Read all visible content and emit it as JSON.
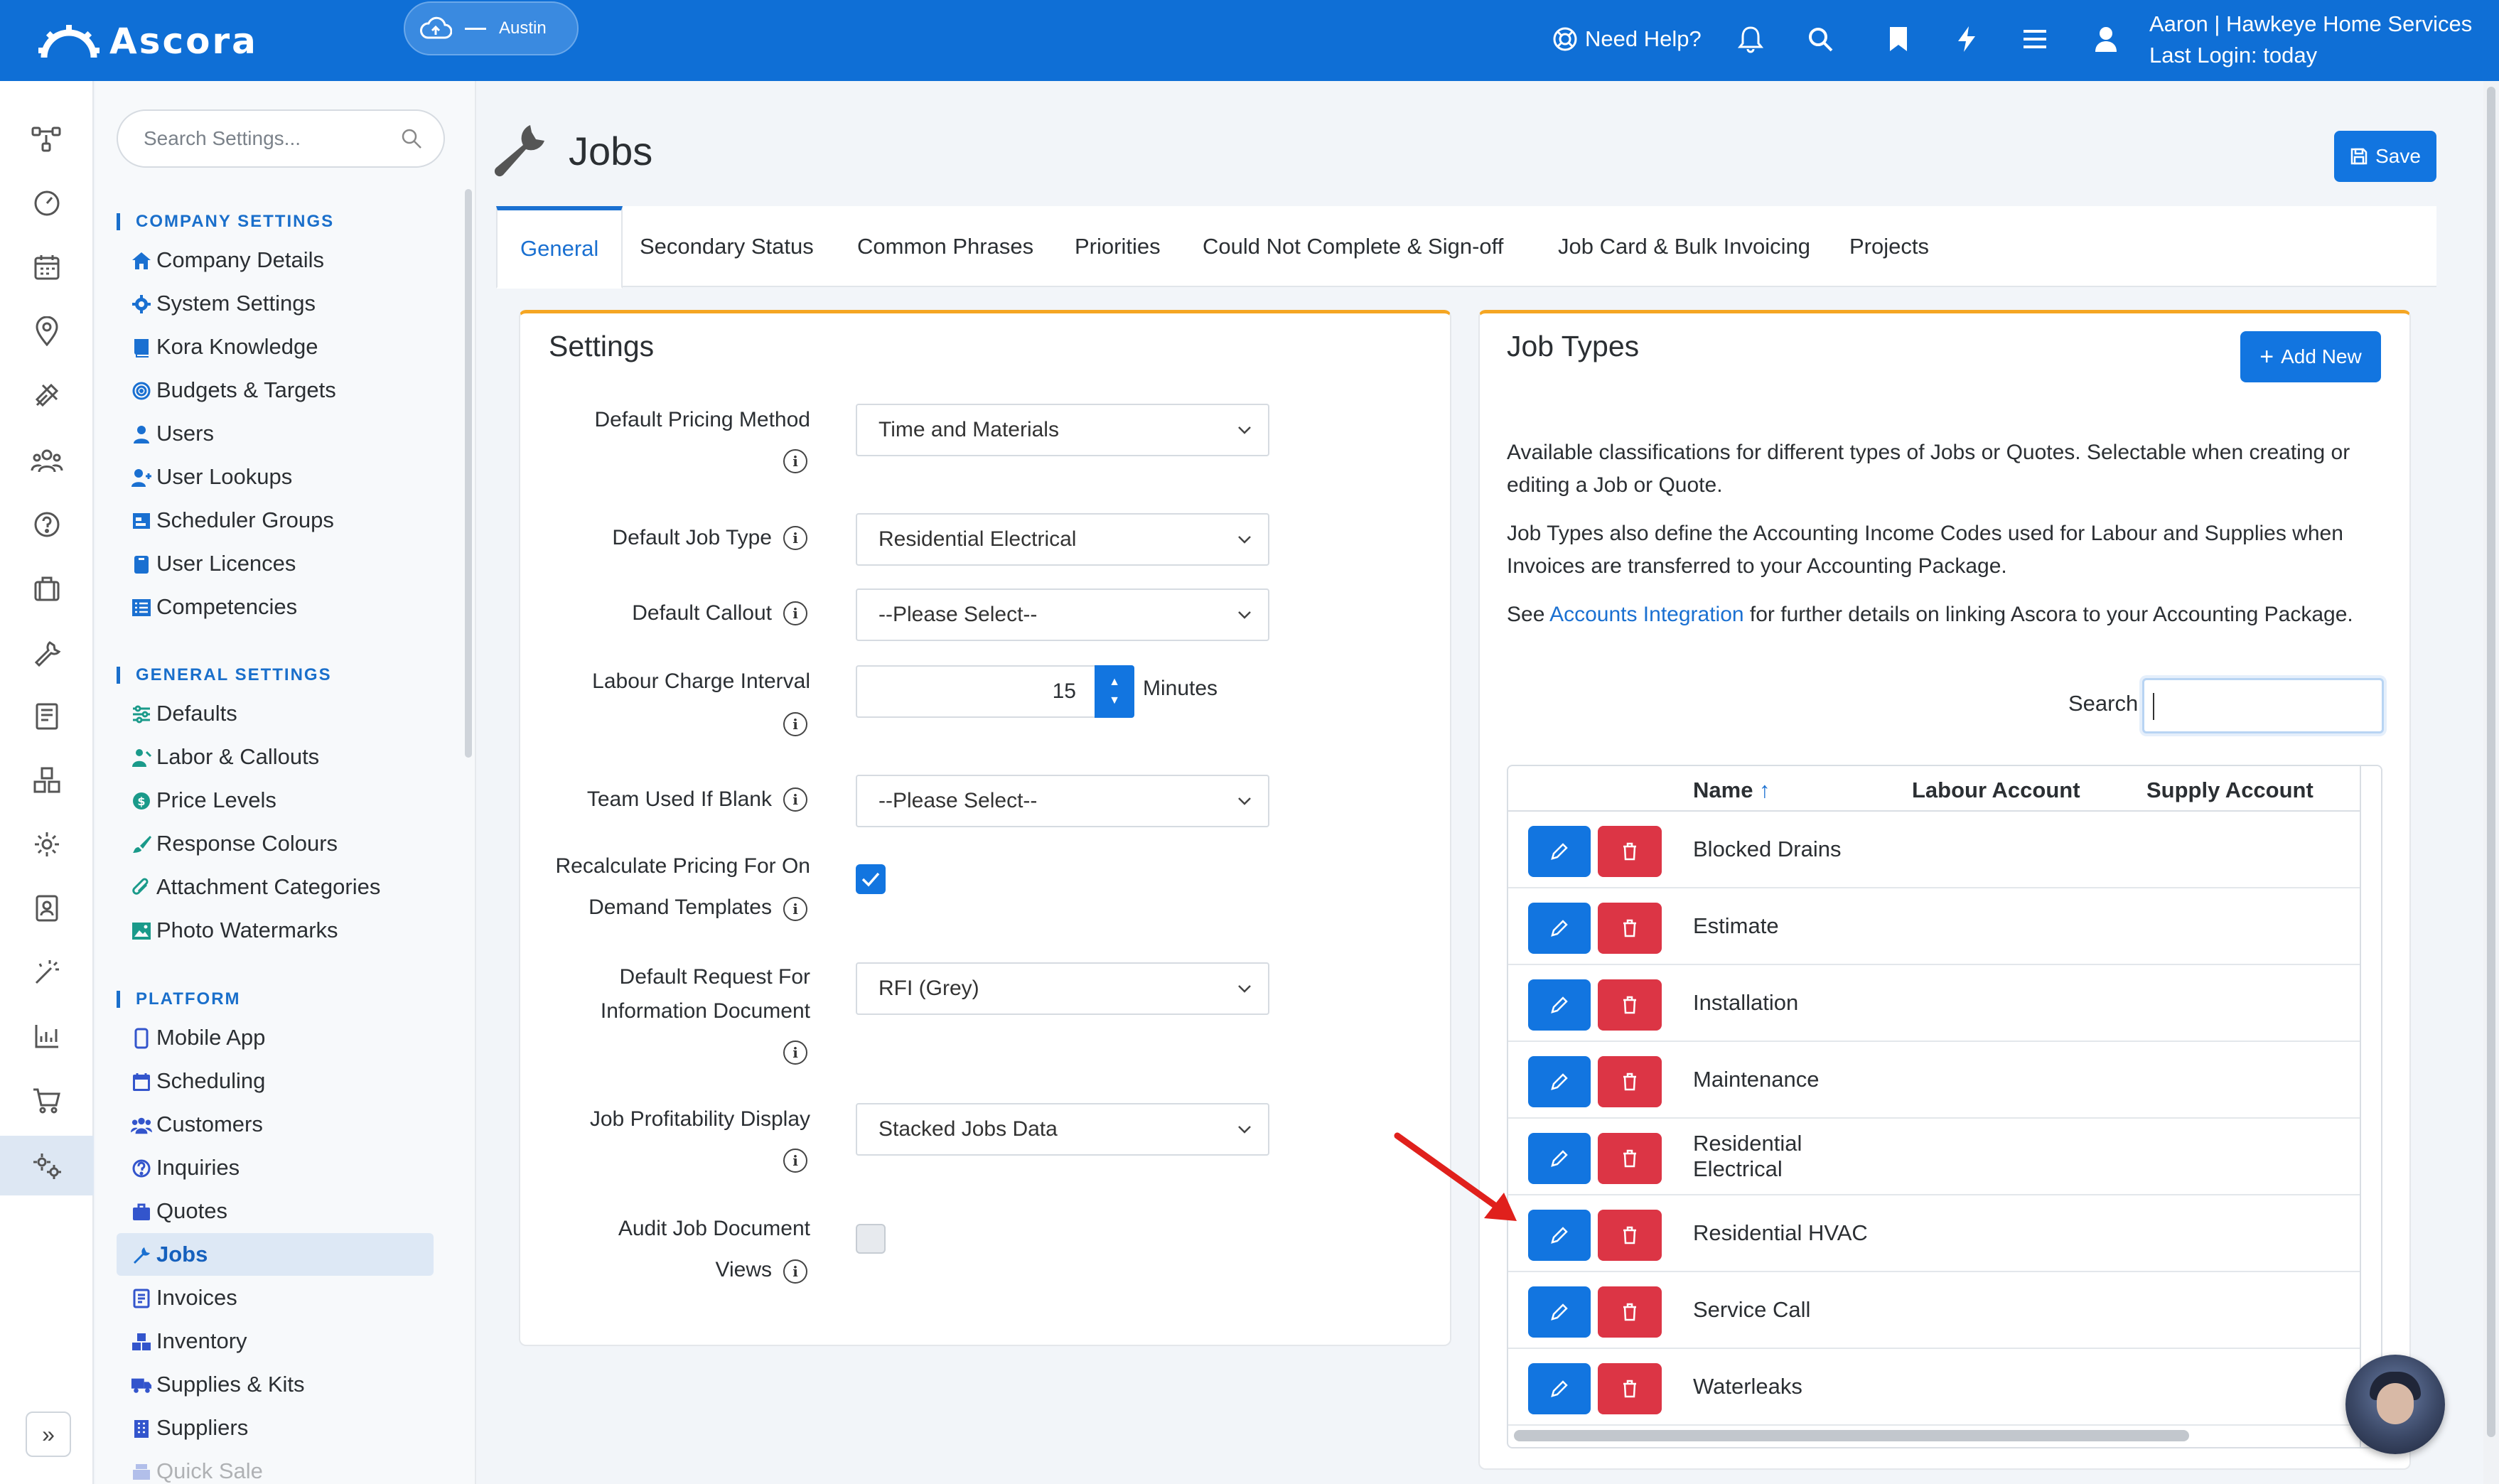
{
  "app": {
    "logo_text": "Ascora",
    "location": "Austin"
  },
  "topbar": {
    "help_label": "Need Help?",
    "user_line1": "Aaron | Hawkeye Home Services",
    "user_line2": "Last Login: today",
    "icons": [
      "bell-icon",
      "search-icon",
      "bookmark-icon",
      "lightning-icon",
      "menu-icon",
      "user-icon"
    ]
  },
  "sidebar": {
    "search_placeholder": "Search Settings...",
    "sections": [
      {
        "title": "COMPANY SETTINGS",
        "items": [
          {
            "label": "Company Details"
          },
          {
            "label": "System Settings"
          },
          {
            "label": "Kora Knowledge"
          },
          {
            "label": "Budgets & Targets"
          },
          {
            "label": "Users"
          },
          {
            "label": "User Lookups"
          },
          {
            "label": "Scheduler Groups"
          },
          {
            "label": "User Licences"
          },
          {
            "label": "Competencies"
          }
        ]
      },
      {
        "title": "GENERAL SETTINGS",
        "items": [
          {
            "label": "Defaults"
          },
          {
            "label": "Labor & Callouts"
          },
          {
            "label": "Price Levels"
          },
          {
            "label": "Response Colours"
          },
          {
            "label": "Attachment Categories"
          },
          {
            "label": "Photo Watermarks"
          }
        ]
      },
      {
        "title": "PLATFORM",
        "items": [
          {
            "label": "Mobile App"
          },
          {
            "label": "Scheduling"
          },
          {
            "label": "Customers"
          },
          {
            "label": "Inquiries"
          },
          {
            "label": "Quotes"
          },
          {
            "label": "Jobs"
          },
          {
            "label": "Invoices"
          },
          {
            "label": "Inventory"
          },
          {
            "label": "Supplies & Kits"
          },
          {
            "label": "Suppliers"
          },
          {
            "label": "Quick Sale"
          }
        ]
      }
    ]
  },
  "page": {
    "title": "Jobs",
    "save_label": "Save",
    "tabs": [
      "General",
      "Secondary Status",
      "Common Phrases",
      "Priorities",
      "Could Not Complete & Sign-off",
      "Job Card & Bulk Invoicing",
      "Projects"
    ],
    "active_tab": "General"
  },
  "settings": {
    "title": "Settings",
    "default_pricing_method": {
      "label": "Default Pricing Method",
      "value": "Time and Materials"
    },
    "default_job_type": {
      "label": "Default Job Type",
      "value": "Residential Electrical"
    },
    "default_callout": {
      "label": "Default Callout",
      "value": "--Please Select--"
    },
    "labour_charge_interval": {
      "label": "Labour Charge Interval",
      "value": "15",
      "unit": "Minutes"
    },
    "team_used_if_blank": {
      "label": "Team Used If Blank",
      "value": "--Please Select--"
    },
    "recalc_pricing": {
      "label_line1": "Recalculate Pricing For On",
      "label_line2": "Demand Templates",
      "checked": true
    },
    "default_rfi_doc": {
      "label_line1": "Default Request For",
      "label_line2": "Information Document",
      "value": "RFI (Grey)"
    },
    "job_profitability_display": {
      "label": "Job Profitability Display",
      "value": "Stacked Jobs Data"
    },
    "audit_job_doc_views": {
      "label_line1": "Audit Job Document",
      "label_line2": "Views",
      "checked": false
    }
  },
  "job_types": {
    "title": "Job Types",
    "add_label": "Add New",
    "desc1": "Available classifications for different types of Jobs or Quotes. Selectable when creating or editing a Job or Quote.",
    "desc2": "Job Types also define the Accounting Income Codes used for Labour and Supplies when Invoices are transferred to your Accounting Package.",
    "desc3_pre": "See ",
    "desc3_link": "Accounts Integration",
    "desc3_post": " for further details on linking Ascora to your Accounting Package.",
    "search_label": "Search",
    "search_value": "",
    "columns": {
      "name": "Name",
      "sort_arrow": "↑",
      "labour": "Labour Account",
      "supply": "Supply Account"
    },
    "rows": [
      {
        "name": "Blocked Drains"
      },
      {
        "name": "Estimate"
      },
      {
        "name": "Installation"
      },
      {
        "name": "Maintenance"
      },
      {
        "name": "Residential Electrical"
      },
      {
        "name": "Residential HVAC"
      },
      {
        "name": "Service Call"
      },
      {
        "name": "Waterleaks"
      }
    ]
  },
  "colors": {
    "brand": "#0f6fd6",
    "primary_button": "#1275e0",
    "danger": "#dc3545",
    "card_accent": "#f5a623",
    "annotation_arrow": "#e0201c"
  }
}
